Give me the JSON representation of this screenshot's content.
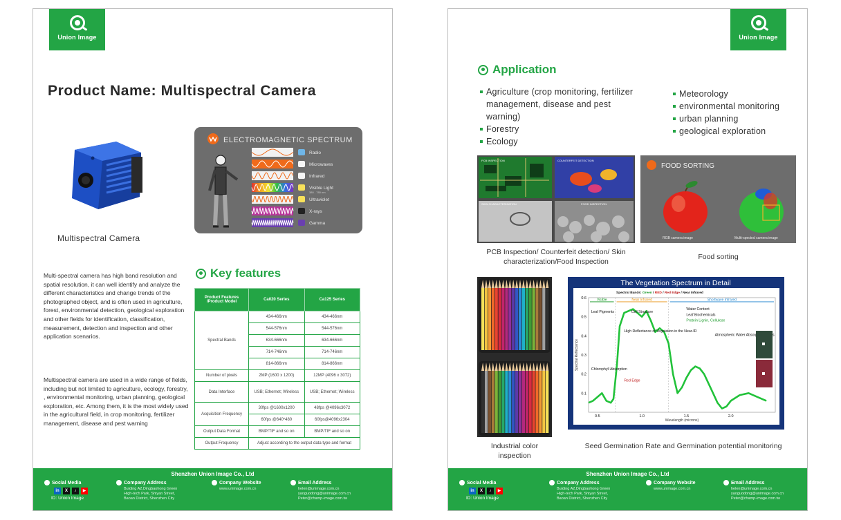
{
  "brand": {
    "logo_text": "Union Image",
    "green": "#23a545"
  },
  "page1": {
    "title": "Product Name: Multispectral Camera",
    "camera_caption": "Multispectral Camera",
    "em_panel": {
      "title": "ELECTROMAGNETIC SPECTRUM",
      "bands": [
        "Radio",
        "Microwaves",
        "Infrared",
        "Visible Light",
        "Ultraviolet",
        "X-rays",
        "Gamma"
      ],
      "visible_sub": "380 - 780 nm"
    },
    "desc1": "Multi-spectral camera has high band resolution and spatial resolution, it can well identify and analyze the different characteristics and change trends of the photographed object, and is often used in agriculture, forest, environmental detection, geological exploration and other fields for identification, classification, measurement, detection and inspection and other application scenarios.",
    "desc2": "Multispectral camera are used in a wide range of fields, including but not limited to agriculture, ecology, forestry, , environmental monitoring, urban planning, geological exploration, etc. Among them, it is the most widely used in the agricultural field, in crop monitoring, fertilizer management, disease and pest warning",
    "key_features": {
      "heading": "Key features",
      "header": [
        "Product Features /Product Model",
        "Ca020 Series",
        "Ca125 Series"
      ],
      "spectral_label": "Spectral Bands",
      "spectral_bands": [
        [
          "434-466nm",
          "434-466nm"
        ],
        [
          "544-576nm",
          "544-576nm"
        ],
        [
          "634-666nm",
          "634-666nm"
        ],
        [
          "714-746nm",
          "714-746nm"
        ],
        [
          "814-866nm",
          "814-866nm"
        ]
      ],
      "pixels_label": "Number of pixels",
      "pixels": [
        "2MP (1600 x 1200)",
        "12MP (4096 x 3072)"
      ],
      "interface_label": "Data Interface",
      "interface": [
        "USB; Ethernet; Wireless",
        "USB; Ethernet; Wireless"
      ],
      "acq_label": "Acquisition Frequency",
      "acq": [
        [
          "30fps @1600x1200",
          "48fps @4096x3072"
        ],
        [
          "60fps @640*480",
          "60fps@4096x2304"
        ]
      ],
      "format_label": "Output Data Format",
      "format": [
        "BMP/TIF and so on",
        "BMP/TIF and so on"
      ],
      "freq_label": "Output Frequency",
      "freq": "Adjust according to the output data type and format"
    }
  },
  "page2": {
    "app_heading": "Application",
    "app_left": [
      "Agriculture (crop monitoring, fertilizer management, disease and pest warning)",
      "Forestry",
      "Ecology"
    ],
    "app_right": [
      "Meteorology",
      "environmental monitoring",
      "urban planning",
      "geological exploration"
    ],
    "pcb_labels": [
      "PCB INSPECTION",
      "COUNTERFEIT DETECTION",
      "SKIN CHARACTERIZATION",
      "FOOD INSPECTION"
    ],
    "pcb_caption": "PCB Inspection/ Counterfeit detection/ Skin characterization/Food Inspection",
    "food_title": "FOOD SORTING",
    "food_labels": [
      "RGB camera image",
      "Multi-spectral camera image"
    ],
    "food_caption": "Food sorting",
    "pencil_caption": "Industrial color inspection",
    "veg_chart": {
      "title": "The Vegetation Spectrum in Detail",
      "bands_line_prefix": "Spectral Bands: ",
      "bands_line": [
        "Green",
        "RED",
        "Red Edge",
        "Near Infrared"
      ],
      "regions": [
        "Visible",
        "Near Infrared",
        "Shortwave Infrared"
      ],
      "annotations": [
        "Leaf Pigments",
        "Cell Structure",
        "Water Content",
        "Leaf Biochemicals",
        "Protein Lignin, Cellulose",
        "High Reflectance of Vegetation in the Near-IR",
        "Atmospheric Water Absorption Bands",
        "Chlorophyll Absorption",
        "Red Edge"
      ],
      "ylabel": "Spectral Reflectance",
      "xlabel": "Wavelength (microns)"
    },
    "seed_caption": "Seed Germination Rate and Germination potential monitoring"
  },
  "footer": {
    "company": "Shenzhen Union Image Co., Ltd",
    "social_title": "Social Media",
    "social_id": "ID: Union Image",
    "address_title": "Company Address",
    "address_lines": [
      "Buiding A2,Dingbaohong Green",
      "High-tech Park, Shiyan Street,",
      "Baoan District, Shenzhen City"
    ],
    "website_title": "Company Website",
    "website": "www.unimage.com.cn",
    "email_title": "Email Address",
    "emails": [
      "helen@unimage.com.cn",
      "yaoguodong@unimage.com.cn",
      "Peter@champ-image.com.tw"
    ]
  },
  "chart_data": {
    "type": "line",
    "title": "The Vegetation Spectrum in Detail",
    "xlabel": "Wavelength (microns)",
    "ylabel": "Spectral Reflectance",
    "xlim": [
      0.4,
      2.5
    ],
    "ylim": [
      0,
      0.6
    ],
    "x_ticks": [
      0.5,
      1.0,
      1.5,
      2.0
    ],
    "y_ticks": [
      0.1,
      0.2,
      0.3,
      0.4,
      0.5,
      0.6
    ],
    "series": [
      {
        "x": [
          0.4,
          0.45,
          0.5,
          0.55,
          0.6,
          0.65,
          0.68,
          0.72,
          0.75,
          0.8,
          0.9,
          1.0,
          1.05,
          1.1,
          1.15,
          1.2,
          1.25,
          1.3,
          1.35,
          1.4,
          1.45,
          1.5,
          1.55,
          1.6,
          1.65,
          1.7,
          1.8,
          1.85,
          1.9,
          1.95,
          2.0,
          2.1,
          2.2,
          2.3,
          2.4
        ],
        "y": [
          0.05,
          0.06,
          0.08,
          0.1,
          0.06,
          0.05,
          0.07,
          0.25,
          0.45,
          0.52,
          0.54,
          0.5,
          0.53,
          0.48,
          0.42,
          0.44,
          0.42,
          0.36,
          0.2,
          0.1,
          0.13,
          0.18,
          0.22,
          0.24,
          0.23,
          0.2,
          0.1,
          0.05,
          0.02,
          0.03,
          0.06,
          0.09,
          0.1,
          0.08,
          0.06
        ]
      }
    ],
    "colors": [
      "#22c23a"
    ]
  }
}
